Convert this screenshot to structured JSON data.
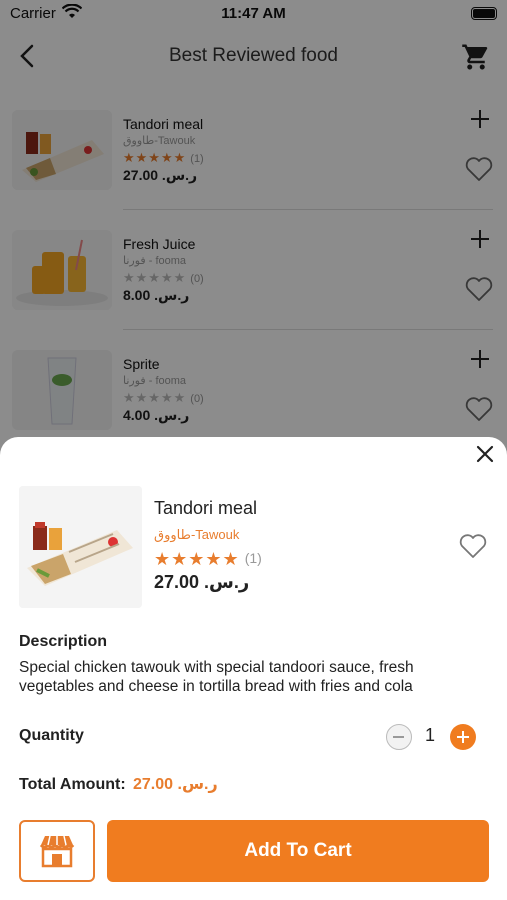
{
  "status_bar": {
    "carrier": "Carrier",
    "time": "11:47 AM"
  },
  "header": {
    "title": "Best Reviewed food"
  },
  "list": [
    {
      "name": "Tandori meal",
      "sub": "طاووق-Tawouk",
      "rating_count": "(1)",
      "rating": 5,
      "price": "27.00 .ر.س"
    },
    {
      "name": "Fresh Juice",
      "sub": "فورنا - fooma",
      "rating_count": "(0)",
      "rating": 0,
      "price": "8.00 .ر.س"
    },
    {
      "name": "Sprite",
      "sub": "فورنا - fooma",
      "rating_count": "(0)",
      "rating": 0,
      "price": "4.00 .ر.س"
    }
  ],
  "sheet": {
    "name": "Tandori meal",
    "sub": "طاووق-Tawouk",
    "stars": "★★★★★",
    "rating_count": "(1)",
    "price": "27.00 .ر.س",
    "description_label": "Description",
    "description": "Special chicken tawouk with special tandoori sauce, fresh vegetables and cheese in tortilla bread with fries and cola",
    "quantity_label": "Quantity",
    "quantity": "1",
    "total_label": "Total Amount:",
    "total_value": "27.00 .ر.س",
    "add_to_cart": "Add To Cart"
  },
  "colors": {
    "accent": "#f07c1f",
    "accent_text": "#e87d2e",
    "star_gold": "#e87d2e",
    "star_empty": "#bbbbbb"
  }
}
